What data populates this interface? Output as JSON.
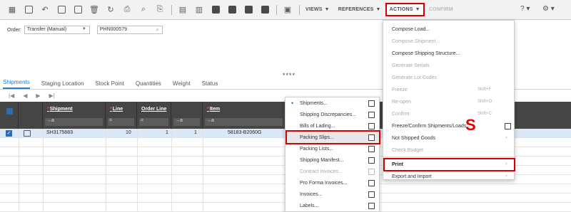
{
  "toolbar": {
    "menus": [
      {
        "label": "VIEWS"
      },
      {
        "label": "REFERENCES"
      },
      {
        "label": "ACTIONS"
      },
      {
        "label": "CONFIRM"
      }
    ],
    "help": "?",
    "settings": "⚙"
  },
  "order": {
    "label": "Order:",
    "type": "Transfer (Manual)",
    "number": "PHN000579"
  },
  "dots": "****",
  "tabs": [
    {
      "label": "Shipments"
    },
    {
      "label": "Staging Location"
    },
    {
      "label": "Stock Point"
    },
    {
      "label": "Quantities"
    },
    {
      "label": "Weight"
    },
    {
      "label": "Status"
    }
  ],
  "pager": [
    "|◀",
    "◀",
    "▶",
    "▶|"
  ],
  "grid": {
    "columns": [
      {
        "title": "Shipment",
        "required": true
      },
      {
        "title": "Line",
        "required": true
      },
      {
        "title": "Order Line",
        "required": false
      },
      {
        "title": "Item",
        "required": true
      }
    ],
    "filter_symbols": {
      "text": "→a",
      "eq": "="
    },
    "rows": [
      {
        "shipment": "SH3175883",
        "line": "10",
        "order_line": "1",
        "col4": "1",
        "item": "58183-B2060G"
      }
    ]
  },
  "submenu": {
    "items": [
      {
        "label": "Shipments...",
        "bullet": true,
        "disabled": false
      },
      {
        "label": "Shipping Discrepancies...",
        "disabled": false
      },
      {
        "label": "Bills of Lading...",
        "disabled": false
      },
      {
        "label": "Packing Slips...",
        "disabled": false
      },
      {
        "label": "Packing Lists...",
        "disabled": false
      },
      {
        "label": "Shipping Manifest...",
        "disabled": false
      },
      {
        "label": "Contract Invoices...",
        "disabled": true
      },
      {
        "label": "Pro Forma Invoices...",
        "disabled": false
      },
      {
        "label": "Invoices...",
        "disabled": false
      },
      {
        "label": "Labels...",
        "disabled": false
      }
    ]
  },
  "actions_menu": {
    "items": [
      {
        "label": "Compose Load...",
        "disabled": false
      },
      {
        "label": "Compose Shipment...",
        "disabled": true
      },
      {
        "label": "Compose Shipping Structure...",
        "disabled": false
      },
      {
        "label": "Generate Serials",
        "disabled": true
      },
      {
        "label": "Generate Lot Codes",
        "disabled": true
      },
      {
        "label": "Freeze",
        "shortcut": "Shift+F",
        "disabled": true
      },
      {
        "label": "Re-open",
        "shortcut": "Shift+O",
        "disabled": true
      },
      {
        "label": "Confirm",
        "shortcut": "Shift+C",
        "disabled": true
      },
      {
        "label": "Freeze/Confirm Shipments/Loads...",
        "disabled": false
      },
      {
        "label": "Not Shipped Goods",
        "disabled": false
      },
      {
        "label": "Check Budget",
        "disabled": true
      },
      {
        "label": "Print",
        "disabled": false
      },
      {
        "label": "Export and Import",
        "disabled": false
      }
    ]
  },
  "annotation": "S",
  "colors": {
    "highlight": "#d40000",
    "accent": "#2b6cb5",
    "grid_header": "#454545"
  }
}
